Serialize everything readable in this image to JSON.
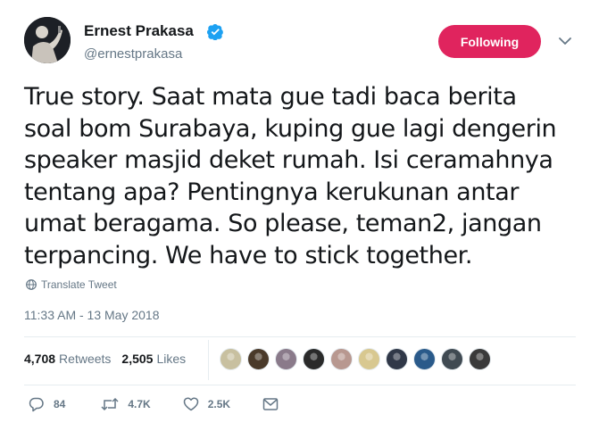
{
  "author": {
    "name": "Ernest Prakasa",
    "handle": "@ernestprakasa",
    "verified": true,
    "avatar_icon": "user-avatar-photo"
  },
  "follow_button": {
    "label": "Following",
    "color": "#e0245e"
  },
  "tweet": {
    "lines": [
      "True story. Saat mata gue tadi baca berita",
      "soal bom Surabaya, kuping gue lagi dengerin",
      "speaker masjid deket rumah. Isi ceramahnya",
      "tentang apa? Pentingnya kerukunan antar",
      "umat beragama. So please, teman2, jangan",
      "terpancing. We have to stick together."
    ]
  },
  "translate_label": "Translate Tweet",
  "timestamp": "11:33 AM - 13 May 2018",
  "stats": {
    "retweets_count": "4,708",
    "retweets_label": "Retweets",
    "likes_count": "2,505",
    "likes_label": "Likes"
  },
  "likers": [
    {
      "color": "#c8c0a0"
    },
    {
      "color": "#4a3a2a"
    },
    {
      "color": "#8a7a8a"
    },
    {
      "color": "#2a2a2a"
    },
    {
      "color": "#b89890"
    },
    {
      "color": "#d8c890"
    },
    {
      "color": "#303848"
    },
    {
      "color": "#2a5a8a"
    },
    {
      "color": "#404a52"
    },
    {
      "color": "#3a3a3a"
    }
  ],
  "actions": {
    "replies": "84",
    "retweets": "4.7K",
    "likes": "2.5K"
  },
  "colors": {
    "text": "#14171a",
    "muted": "#657786",
    "verified": "#1da1f2",
    "divider": "#e6ecf0"
  }
}
